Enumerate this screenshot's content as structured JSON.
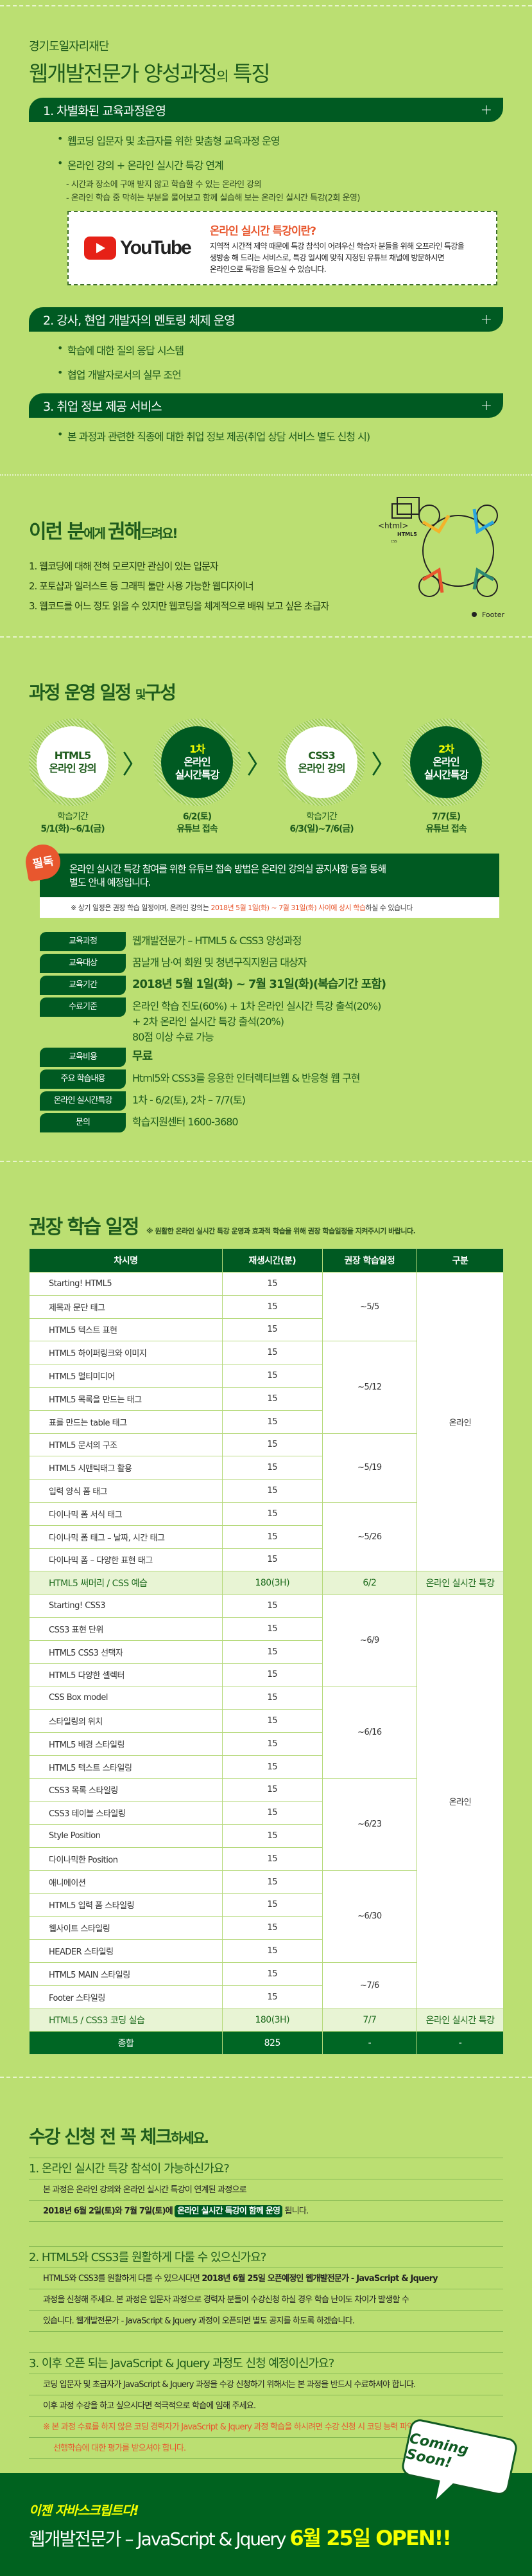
{
  "features": {
    "org": "경기도일자리재단",
    "title_main": "웹개발전문가 양성과정",
    "title_small": "의",
    "title_end": "특징",
    "sections": [
      {
        "label": "1. 차별화된 교육과정운영",
        "bullets": [
          "웹코딩 입문자 및 초급자를 위한 맞춤형 교육과정 운영",
          "온라인 강의 + 온라인 실시간 특강 연계"
        ],
        "sublines": [
          "- 시간과 장소에 구애 받지 않고 학습할 수 있는 온라인 강의",
          "- 온라인 학습 중 막히는 부분을 물어보고 함께 실습해 보는 온라인 실시간 특강(2회 운영)"
        ]
      },
      {
        "label": "2. 강사, 현업 개발자의 멘토링 체제 운영",
        "bullets": [
          "학습에 대한 질의 응답 시스템",
          "협업 개발자로서의 실무 조언"
        ]
      },
      {
        "label": "3. 취업 정보 제공 서비스",
        "bullets": [
          "본 과정과 관련한 직종에 대한 취업 정보 제공(취업 상담 서비스 별도 신청 시)"
        ]
      }
    ],
    "expand_icon": "+",
    "youtube": {
      "logo_text": "YouTube",
      "heading": "온라인 실시간 특강이란?",
      "lines": [
        "지역적 시간적 제약 때문에 특강 참석이 어려우신 학습자 분들을 위해 오프라인 특강을",
        "생방송 해 드리는 서비스로, 특강 일시에 맞춰 지정된 유튜브 채널에 방문하시면",
        "온라인으로 특강을 들으실 수 있습니다."
      ]
    }
  },
  "recommend": {
    "title_a": "이런 분",
    "title_b": "에게 ",
    "title_c": "권해",
    "title_d": "드려요!",
    "items": [
      "1. 웹코딩에 대해 전혀 모르지만 관심이 있는 입문자",
      "2. 포토샵과 일러스트 등 그래픽 툴만 사용 가능한 웹디자이너",
      "3. 웹코드를 어느 정도 읽을 수 있지만 웹코딩을 체계적으로 배워 보고 싶은 초급자"
    ],
    "illus_labels": {
      "html": "<html>",
      "html5": "HTML5",
      "css": "CSS",
      "footer": "Footer",
      "dots": "..."
    }
  },
  "schedule": {
    "title_a": "과정 운영 일정",
    "title_b": "및",
    "title_c": "구성",
    "steps": [
      {
        "top": "",
        "l1": "HTML5",
        "l2": "온라인 강의",
        "label1": "학습기간",
        "label2": "5/1(화)~6/1(금)"
      },
      {
        "top": "1차",
        "l1": "온라인",
        "l2": "실시간특강",
        "label1": "6/2(토)",
        "label2": "유튜브 접속"
      },
      {
        "top": "",
        "l1": "CSS3",
        "l2": "온라인 강의",
        "label1": "학습기간",
        "label2": "6/3(일)~7/6(금)"
      },
      {
        "top": "2차",
        "l1": "온라인",
        "l2": "실시간특강",
        "label1": "7/7(토)",
        "label2": "유튜브 접속"
      }
    ],
    "arrow": "〉",
    "notice_badge": "필독",
    "notice_line1": "온라인 실시간 특강 참여를 위한 유튜브 접속 방법은 온라인 강의실 공지사항 등을 통해",
    "notice_line2": "별도 안내 예정입니다.",
    "footnote_a": "※ 상기 일정은 권장 학습 일정이며, 온라인 강의는 ",
    "footnote_red": "2018년 5월 1일(화) ~ 7월 31일(화) 사이에 상시 학습",
    "footnote_b": "하실 수 있습니다",
    "info": [
      {
        "key": "교육과정",
        "val": [
          "웹개발전문가 – HTML5 & CSS3 양성과정"
        ]
      },
      {
        "key": "교육대상",
        "val": [
          "꿈날개 남·여 회원 및 청년구직지원금 대상자"
        ]
      },
      {
        "key": "교육기간",
        "val": [
          "2018년 5월 1일(화) ~ 7월 31일(화)(복습기간 포함)"
        ],
        "bold": true
      },
      {
        "key": "수료기준",
        "val": [
          "온라인 학습 진도(60%) + 1차 온라인 실시간 특강 출석(20%)",
          "+ 2차 온라인 실시간 특강 출석(20%)",
          "80점 이상 수료 가능"
        ]
      },
      {
        "key": "교육비용",
        "val": [
          "무료"
        ],
        "bold": true
      },
      {
        "key": "주요 학습내용",
        "val": [
          "Html5와 CSS3를 응용한 인터렉티브웹 & 반응형 웹 구현"
        ]
      },
      {
        "key": "온라인 실시간특강",
        "val": [
          "1차 - 6/2(토),  2차 – 7/7(토)"
        ]
      },
      {
        "key": "문의",
        "val": [
          "학습지원센터 1600-3680"
        ]
      }
    ]
  },
  "learning": {
    "title": "권장 학습 일정",
    "note": "※ 원활한 온라인 실시간 특강 운영과 효과적 학습을 위해 권장 학습일정을 지켜주시기 바랍니다.",
    "headers": [
      "차시명",
      "재생시간(분)",
      "권장 학습일정",
      "구분"
    ],
    "rows": [
      {
        "name": "Starting! HTML5",
        "min": "15"
      },
      {
        "name": "제목과 문단 태그",
        "min": "15"
      },
      {
        "name": "HTML5 텍스트 표현",
        "min": "15"
      },
      {
        "name": "HTML5 하이퍼링크와 이미지",
        "min": "15"
      },
      {
        "name": "HTML5 멀티미디어",
        "min": "15"
      },
      {
        "name": "HTML5 목록을 만드는 태그",
        "min": "15"
      },
      {
        "name": "표를 만드는 table 태그",
        "min": "15"
      },
      {
        "name": "HTML5 문서의 구조",
        "min": "15"
      },
      {
        "name": "HTML5 시맨틱태그 활용",
        "min": "15"
      },
      {
        "name": "입력 양식 폼 태그",
        "min": "15"
      },
      {
        "name": "다이나믹 폼 서식 태그",
        "min": "15"
      },
      {
        "name": "다이나믹 폼 태그 – 날짜, 시간 태그",
        "min": "15"
      },
      {
        "name": "다이나믹 폼 – 다양한 표현 태그",
        "min": "15"
      },
      {
        "name": "HTML5 써머리 / CSS 예습",
        "min": "180(3H)",
        "date": "6/2",
        "type": "온라인 실시간 특강",
        "hl": true
      },
      {
        "name": "Starting! CSS3",
        "min": "15"
      },
      {
        "name": "CSS3 표현 단위",
        "min": "15"
      },
      {
        "name": "HTML5 CSS3 선택자",
        "min": "15"
      },
      {
        "name": "HTML5 다양한 셀렉터",
        "min": "15"
      },
      {
        "name": "CSS Box model",
        "min": "15"
      },
      {
        "name": "스타일링의 위치",
        "min": "15"
      },
      {
        "name": "HTML5 배경 스타일링",
        "min": "15"
      },
      {
        "name": "HTML5 텍스트 스타일링",
        "min": "15"
      },
      {
        "name": "CSS3 목록 스타일링",
        "min": "15"
      },
      {
        "name": "CSS3 테이블 스타일링",
        "min": "15"
      },
      {
        "name": "Style Position",
        "min": "15"
      },
      {
        "name": "다이나믹한 Position",
        "min": "15"
      },
      {
        "name": "애니메이션",
        "min": "15"
      },
      {
        "name": "HTML5 입력 폼 스타일링",
        "min": "15"
      },
      {
        "name": "웹사이트 스타일링",
        "min": "15"
      },
      {
        "name": "HEADER 스타일링",
        "min": "15"
      },
      {
        "name": "HTML5 MAIN 스타일링",
        "min": "15"
      },
      {
        "name": "Footer 스타일링",
        "min": "15"
      },
      {
        "name": "HTML5 / CSS3 코딩 실습",
        "min": "180(3H)",
        "date": "7/7",
        "type": "온라인 실시간 특강",
        "hl": true
      }
    ],
    "date_groups": [
      {
        "start": 0,
        "span": 3,
        "label": "~5/5"
      },
      {
        "start": 3,
        "span": 4,
        "label": "~5/12"
      },
      {
        "start": 7,
        "span": 3,
        "label": "~5/19"
      },
      {
        "start": 10,
        "span": 3,
        "label": "~5/26"
      },
      {
        "start": 14,
        "span": 4,
        "label": "~6/9"
      },
      {
        "start": 18,
        "span": 4,
        "label": "~6/16"
      },
      {
        "start": 22,
        "span": 4,
        "label": "~6/23"
      },
      {
        "start": 26,
        "span": 4,
        "label": "~6/30"
      },
      {
        "start": 30,
        "span": 2,
        "label": "~7/6"
      }
    ],
    "type_groups": [
      {
        "start": 0,
        "span": 13,
        "label": "온라인"
      },
      {
        "start": 14,
        "span": 18,
        "label": "온라인"
      }
    ],
    "total": {
      "name": "종합",
      "min": "825",
      "date": "-",
      "type": "-"
    }
  },
  "check": {
    "title_a": "수강 신청 전 꼭 체크",
    "title_b": "하세요.",
    "q1": "1. 온라인 실시간 특강 참석이 가능하신가요?",
    "q1_line1": "본 과정은 온라인 강의와 온라인 실시간 특강이 연계된 과정으로",
    "q1_line2_bold": "2018년 6월 2일(토)와 7월 7일(토)에",
    "q1_line2_hl": "온라인 실시간 특강이 함께 운영",
    "q1_line2_end": "됩니다.",
    "q2": "2. HTML5와 CSS3를 원활하게 다룰 수 있으신가요?",
    "q2_line1_a": "HTML5와 CSS3를 원활하게 다룰 수 있으시다면 ",
    "q2_line1_b": "2018년 6월 25일 오픈예정인 웹개발전문가 - JavaScript & Jquery",
    "q2_line2": "과정을 신청해 주세요. 본 과정은 입문자 과정으로 경력자 분들이 수강신청 하실 경우 학습 난이도 차이가 발생할 수",
    "q2_line3": "있습니다. 웹개발전문가 - JavaScript & Jquery 과정이 오픈되면 별도 공지를 하도록 하겠습니다.",
    "q3": "3. 이후 오픈 되는 JavaScript & Jquery 과정도 신청 예정이신가요?",
    "q3_line1": "코딩 입문자 및 초급자가 JavaScript & Jquery 과정을 수강 신청하기 위해서는 본 과정을 반드시 수료하셔야 합니다.",
    "q3_line2": "이후 과정 수강을 하고 싶으시다면 적극적으로 학습에 임해 주세요.",
    "q3_line3": "※ 본 과정 수료를 하지 않은 코딩 경력자가 JavaScript & Jquery 과정 학습을 하시려면 수강 신청 시 코딩 능력 파악을 위한",
    "q3_line4": "선행학습에 대한 평가를 받으셔야 합니다."
  },
  "banner": {
    "tagline": "이젠 자바스크립트다!",
    "main": "웹개발전문가 – JavaScript & Jquery ",
    "highlight": "6월 25일 OPEN!!",
    "bubble": "Coming Soon!"
  },
  "colors": {
    "bg": "#bbdf72",
    "dark_green": "#005a22",
    "accent_red": "#e8572e",
    "yellow": "#f5ff00"
  }
}
